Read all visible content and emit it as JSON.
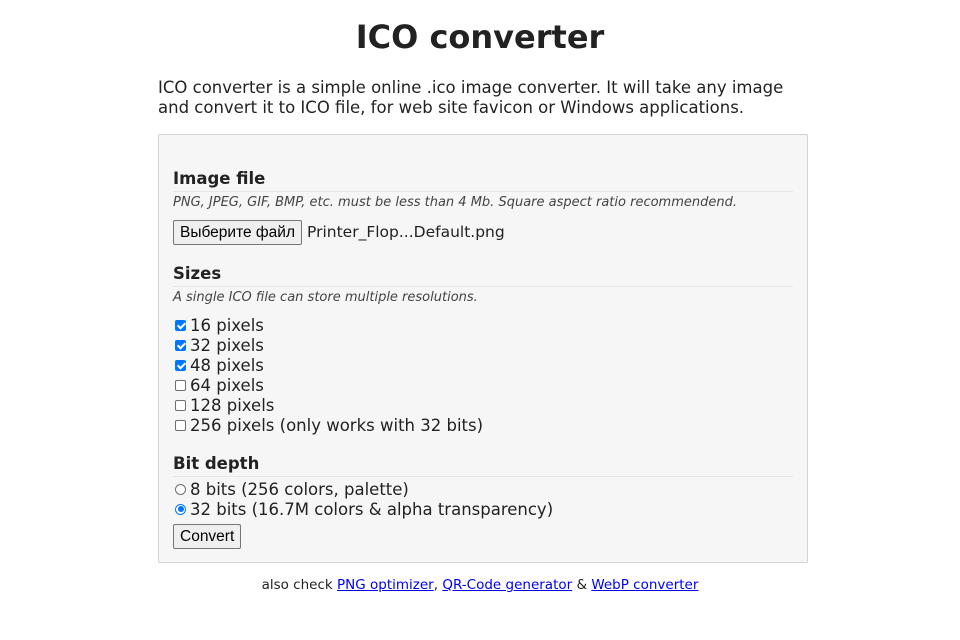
{
  "header": {
    "title": "ICO converter"
  },
  "intro": {
    "text": "ICO converter is a simple online .ico image converter. It will take any image and convert it to ICO file, for web site favicon or Windows applications."
  },
  "image_file": {
    "title": "Image file",
    "hint": "PNG, JPEG, GIF, BMP, etc. must be less than 4 Mb. Square aspect ratio recommendend.",
    "button_label": "Выберите файл",
    "file_name": "Printer_Flop...Default.png"
  },
  "sizes": {
    "title": "Sizes",
    "hint": "A single ICO file can store multiple resolutions.",
    "options": [
      {
        "label": "16 pixels",
        "checked": true
      },
      {
        "label": "32 pixels",
        "checked": true
      },
      {
        "label": "48 pixels",
        "checked": true
      },
      {
        "label": "64 pixels",
        "checked": false
      },
      {
        "label": "128 pixels",
        "checked": false
      },
      {
        "label": "256 pixels (only works with 32 bits)",
        "checked": false
      }
    ]
  },
  "bit_depth": {
    "title": "Bit depth",
    "options": [
      {
        "label": "8 bits (256 colors, palette)",
        "checked": false
      },
      {
        "label": "32 bits (16.7M colors & alpha transparency)",
        "checked": true
      }
    ]
  },
  "convert_label": "Convert",
  "footer": {
    "prefix": "also check",
    "links": [
      "PNG optimizer",
      "QR-Code generator",
      "WebP converter"
    ],
    "sep_comma": ",",
    "sep_amp": "&"
  },
  "colors": {
    "accent": "#0075ff",
    "link": "#0000ee",
    "panel_bg": "#f6f6f6"
  }
}
